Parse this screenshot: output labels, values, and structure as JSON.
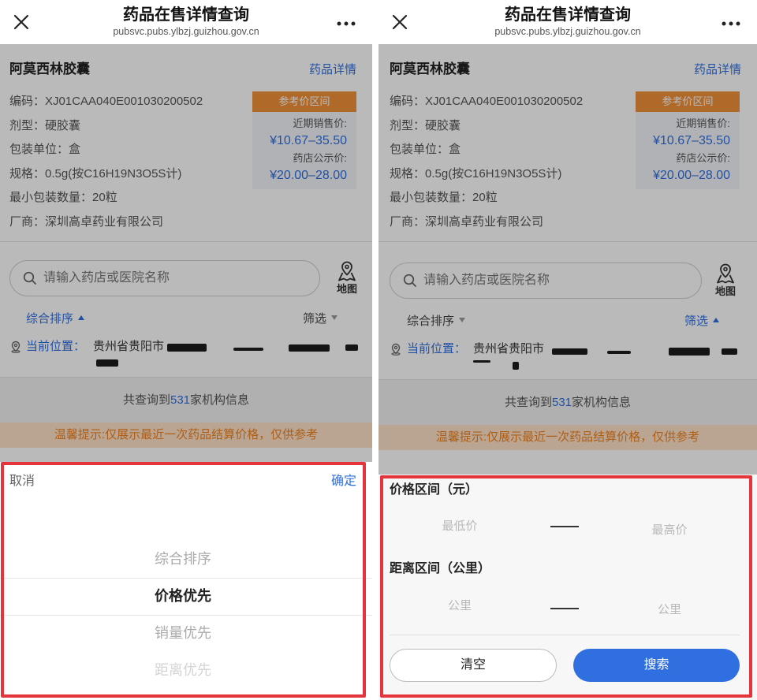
{
  "header": {
    "title": "药品在售详情查询",
    "subtitle": "pubsvc.pubs.ylbzj.guizhou.gov.cn"
  },
  "drug": {
    "name": "阿莫西林胶囊",
    "detail_link": "药品详情",
    "fields": [
      {
        "label": "编码：",
        "value": "XJ01CAA040E001030200502"
      },
      {
        "label": "剂型：",
        "value": "硬胶囊"
      },
      {
        "label": "包装单位：",
        "value": "盒"
      },
      {
        "label": "规格：",
        "value": "0.5g(按C16H19N3O5S计)"
      },
      {
        "label": "最小包装数量：",
        "value": "20粒"
      },
      {
        "label": "厂商：",
        "value": "深圳高卓药业有限公司"
      }
    ],
    "price": {
      "title": "参考价区间",
      "recent_label": "近期销售价:",
      "recent_range": "¥10.67–35.50",
      "pharmacy_label": "药店公示价:",
      "pharmacy_range": "¥20.00–28.00"
    }
  },
  "search": {
    "placeholder": "请输入药店或医院名称",
    "map_label": "地图"
  },
  "sort_bar": {
    "sort_label": "综合排序",
    "filter_label": "筛选"
  },
  "location": {
    "label": "当前位置：",
    "value": "贵州省贵阳市"
  },
  "result": {
    "prefix": "共查询到",
    "count": "531",
    "suffix": "家机构信息"
  },
  "tip": "温馨提示:仅展示最近一次药品结算价格，仅供参考",
  "sort_picker": {
    "cancel_label": "取消",
    "confirm_label": "确定",
    "options": [
      "综合排序",
      "价格优先",
      "销量优先",
      "距离优先"
    ],
    "selected_index": 1
  },
  "filter_panel": {
    "price_title": "价格区间（元）",
    "price_min_placeholder": "最低价",
    "price_max_placeholder": "最高价",
    "distance_title": "距离区间（公里）",
    "distance_min_placeholder": "公里",
    "distance_max_placeholder": "公里",
    "clear_label": "清空",
    "search_label": "搜索"
  },
  "screens": [
    {
      "sort_expanded": true,
      "filter_expanded": false
    },
    {
      "sort_expanded": false,
      "filter_expanded": true
    }
  ],
  "icons": {
    "close": "close-icon",
    "more": "more-icon",
    "search": "search-icon",
    "map": "map-icon",
    "location": "location-pin-icon",
    "caret_up": "caret-up-icon",
    "caret_down": "caret-down-icon"
  },
  "colors": {
    "accent": "#2f6fe0",
    "price_header": "#f0923a",
    "tip_text": "#f0821e",
    "tip_background": "#ffe3c8",
    "highlight_border": "#e5343c"
  }
}
